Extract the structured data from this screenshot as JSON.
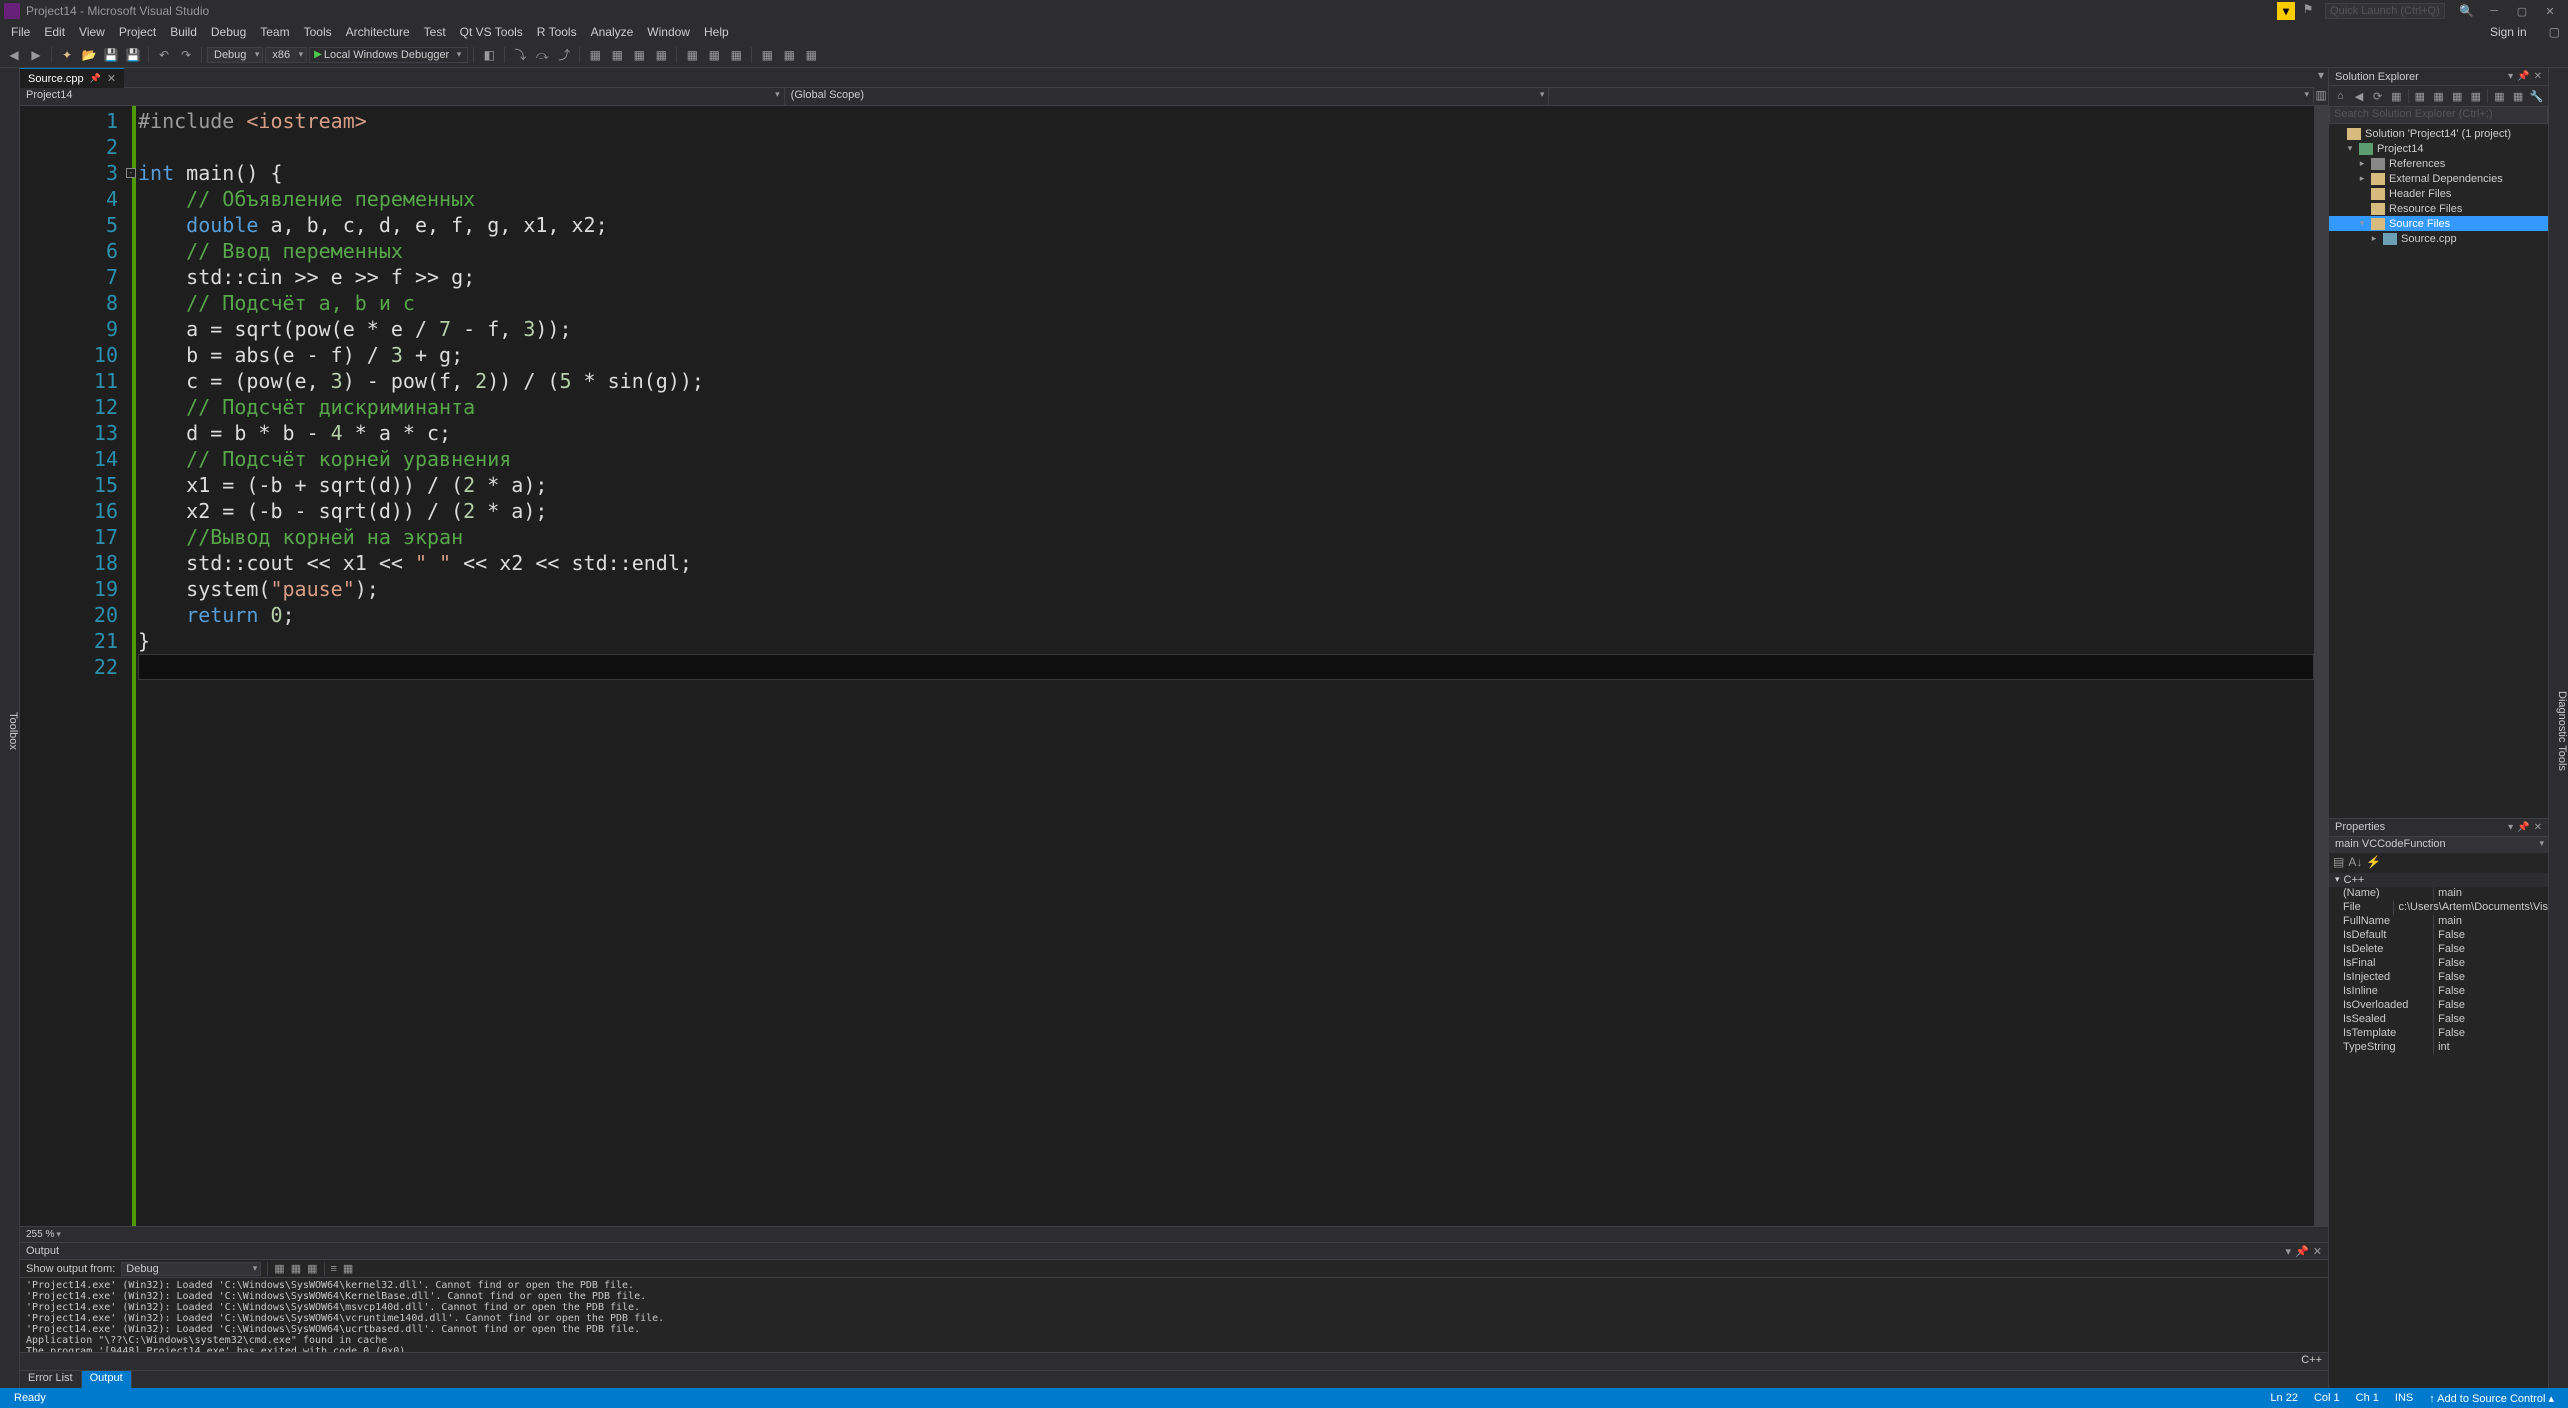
{
  "title": "Project14 - Microsoft Visual Studio",
  "quick_launch_placeholder": "Quick Launch (Ctrl+Q)",
  "menu": [
    "File",
    "Edit",
    "View",
    "Project",
    "Build",
    "Debug",
    "Team",
    "Tools",
    "Architecture",
    "Test",
    "Qt VS Tools",
    "R Tools",
    "Analyze",
    "Window",
    "Help"
  ],
  "signin": "Sign in",
  "toolbar": {
    "config": "Debug",
    "platform": "x86",
    "debugger": "Local Windows Debugger"
  },
  "left_tab": "Toolbox",
  "right_tab": "Diagnostic Tools",
  "editor": {
    "tab": "Source.cpp",
    "nav1": "Project14",
    "nav2": "(Global Scope)",
    "nav3": "",
    "zoom": "255 %",
    "lines": [
      {
        "n": "1",
        "seg": [
          [
            "pp",
            "#include "
          ],
          [
            "inc",
            "<iostream>"
          ]
        ]
      },
      {
        "n": "2",
        "seg": []
      },
      {
        "n": "3",
        "fold": true,
        "seg": [
          [
            "kw",
            "int"
          ],
          [
            "",
            " main() {"
          ]
        ]
      },
      {
        "n": "4",
        "seg": [
          [
            "",
            "    "
          ],
          [
            "cm",
            "// Объявление переменных"
          ]
        ]
      },
      {
        "n": "5",
        "seg": [
          [
            "",
            "    "
          ],
          [
            "kw",
            "double"
          ],
          [
            "",
            " a, b, c, d, e, f, g, x1, x2;"
          ]
        ]
      },
      {
        "n": "6",
        "seg": [
          [
            "",
            "    "
          ],
          [
            "cm",
            "// Ввод переменных"
          ]
        ]
      },
      {
        "n": "7",
        "seg": [
          [
            "",
            "    std::cin >> e >> f >> g;"
          ]
        ]
      },
      {
        "n": "8",
        "seg": [
          [
            "",
            "    "
          ],
          [
            "cm",
            "// Подсчёт a, b и c"
          ]
        ]
      },
      {
        "n": "9",
        "seg": [
          [
            "",
            "    a = sqrt(pow(e * e / "
          ],
          [
            "num",
            "7"
          ],
          [
            "",
            " - f, "
          ],
          [
            "num",
            "3"
          ],
          [
            "",
            "));"
          ]
        ]
      },
      {
        "n": "10",
        "seg": [
          [
            "",
            "    b = abs(e - f) / "
          ],
          [
            "num",
            "3"
          ],
          [
            "",
            " + g;"
          ]
        ]
      },
      {
        "n": "11",
        "seg": [
          [
            "",
            "    c = (pow(e, "
          ],
          [
            "num",
            "3"
          ],
          [
            "",
            ") - pow(f, "
          ],
          [
            "num",
            "2"
          ],
          [
            "",
            ")) / ("
          ],
          [
            "num",
            "5"
          ],
          [
            "",
            " * sin(g));"
          ]
        ]
      },
      {
        "n": "12",
        "seg": [
          [
            "",
            "    "
          ],
          [
            "cm",
            "// Подсчёт дискриминанта"
          ]
        ]
      },
      {
        "n": "13",
        "seg": [
          [
            "",
            "    d = b * b - "
          ],
          [
            "num",
            "4"
          ],
          [
            "",
            " * a * c;"
          ]
        ]
      },
      {
        "n": "14",
        "seg": [
          [
            "",
            "    "
          ],
          [
            "cm",
            "// Подсчёт корней уравнения"
          ]
        ]
      },
      {
        "n": "15",
        "seg": [
          [
            "",
            "    x1 = (-b + sqrt(d)) / ("
          ],
          [
            "num",
            "2"
          ],
          [
            "",
            " * a);"
          ]
        ]
      },
      {
        "n": "16",
        "seg": [
          [
            "",
            "    x2 = (-b - sqrt(d)) / ("
          ],
          [
            "num",
            "2"
          ],
          [
            "",
            " * a);"
          ]
        ]
      },
      {
        "n": "17",
        "seg": [
          [
            "",
            "    "
          ],
          [
            "cm",
            "//Вывод корней на экран"
          ]
        ]
      },
      {
        "n": "18",
        "seg": [
          [
            "",
            "    std::cout << x1 << "
          ],
          [
            "str",
            "\" \""
          ],
          [
            "",
            " << x2 << std::endl;"
          ]
        ]
      },
      {
        "n": "19",
        "seg": [
          [
            "",
            "    system("
          ],
          [
            "str",
            "\"pause\""
          ],
          [
            "",
            ");"
          ]
        ]
      },
      {
        "n": "20",
        "seg": [
          [
            "",
            "    "
          ],
          [
            "kw",
            "return"
          ],
          [
            "",
            " "
          ],
          [
            "num",
            "0"
          ],
          [
            "",
            ";"
          ]
        ]
      },
      {
        "n": "21",
        "seg": [
          [
            "",
            "}"
          ]
        ]
      },
      {
        "n": "22",
        "seg": [],
        "current": true
      }
    ]
  },
  "output": {
    "title": "Output",
    "show_label": "Show output from:",
    "source": "Debug",
    "text": "'Project14.exe' (Win32): Loaded 'C:\\Windows\\SysWOW64\\kernel32.dll'. Cannot find or open the PDB file.\n'Project14.exe' (Win32): Loaded 'C:\\Windows\\SysWOW64\\KernelBase.dll'. Cannot find or open the PDB file.\n'Project14.exe' (Win32): Loaded 'C:\\Windows\\SysWOW64\\msvcp140d.dll'. Cannot find or open the PDB file.\n'Project14.exe' (Win32): Loaded 'C:\\Windows\\SysWOW64\\vcruntime140d.dll'. Cannot find or open the PDB file.\n'Project14.exe' (Win32): Loaded 'C:\\Windows\\SysWOW64\\ucrtbased.dll'. Cannot find or open the PDB file.\nApplication \"\\??\\C:\\Windows\\system32\\cmd.exe\" found in cache\nThe program '[9448] Project14.exe' has exited with code 0 (0x0)."
  },
  "lang_indicator": "C++",
  "bottom_tabs": {
    "error_list": "Error List",
    "output": "Output"
  },
  "status": {
    "ready": "Ready",
    "ln": "Ln 22",
    "col": "Col 1",
    "ch": "Ch 1",
    "ins": "INS",
    "scc": "↑ Add to Source Control ▴"
  },
  "solution_explorer": {
    "title": "Solution Explorer",
    "search_placeholder": "Search Solution Explorer (Ctrl+;)",
    "nodes": [
      {
        "d": 0,
        "exp": "",
        "ic": "ic-sln",
        "label": "Solution 'Project14' (1 project)"
      },
      {
        "d": 1,
        "exp": "▾",
        "ic": "ic-proj",
        "label": "Project14"
      },
      {
        "d": 2,
        "exp": "▸",
        "ic": "ic-ref",
        "label": "References"
      },
      {
        "d": 2,
        "exp": "▸",
        "ic": "ic-fold",
        "label": "External Dependencies"
      },
      {
        "d": 2,
        "exp": "",
        "ic": "ic-fold",
        "label": "Header Files"
      },
      {
        "d": 2,
        "exp": "",
        "ic": "ic-fold",
        "label": "Resource Files"
      },
      {
        "d": 2,
        "exp": "▾",
        "ic": "ic-fold",
        "label": "Source Files",
        "sel": true
      },
      {
        "d": 3,
        "exp": "▸",
        "ic": "ic-cpp",
        "label": "Source.cpp"
      }
    ]
  },
  "properties": {
    "title": "Properties",
    "obj": "main VCCodeFunction",
    "cat": "C++",
    "rows": [
      {
        "k": "(Name)",
        "v": "main"
      },
      {
        "k": "File",
        "v": "c:\\Users\\Artem\\Documents\\Vis"
      },
      {
        "k": "FullName",
        "v": "main"
      },
      {
        "k": "IsDefault",
        "v": "False"
      },
      {
        "k": "IsDelete",
        "v": "False"
      },
      {
        "k": "IsFinal",
        "v": "False"
      },
      {
        "k": "IsInjected",
        "v": "False"
      },
      {
        "k": "IsInline",
        "v": "False"
      },
      {
        "k": "IsOverloaded",
        "v": "False"
      },
      {
        "k": "IsSealed",
        "v": "False"
      },
      {
        "k": "IsTemplate",
        "v": "False"
      },
      {
        "k": "TypeString",
        "v": "int"
      }
    ]
  }
}
